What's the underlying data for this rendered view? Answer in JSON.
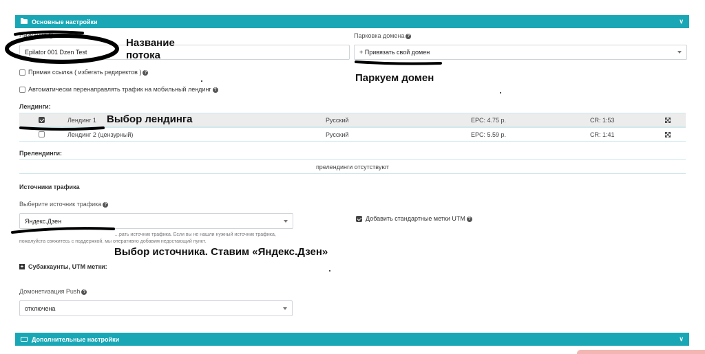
{
  "main_settings": {
    "title": "Основные настройки"
  },
  "extra_settings": {
    "title": "Дополнительные настройки"
  },
  "name_field": {
    "label": "Название",
    "value": "Epilator 001 Dzen Test"
  },
  "domain_parking": {
    "label": "Парковка домена",
    "value": "+ Привязать свой домен"
  },
  "checkboxes": {
    "direct_link": "Прямая ссылка ( избегать редиректов )",
    "mobile_redirect": "Автоматически перенаправлять трафик на мобильный лендинг"
  },
  "landings": {
    "heading": "Лендинги:",
    "rows": [
      {
        "name": "Лендинг 1",
        "lang": "Русский",
        "epc": "EPC: 4.75 р.",
        "cr": "CR: 1:53",
        "checked": true
      },
      {
        "name": "Лендинг 2 (цензурный)",
        "lang": "Русский",
        "epc": "EPC: 5.59 р.",
        "cr": "CR: 1:41",
        "checked": false
      }
    ]
  },
  "prelandings": {
    "heading": "Прелендинги:",
    "empty": "прелендинги отсутствуют"
  },
  "traffic": {
    "heading": "Источники трафика",
    "select_label": "Выберите источник трафика",
    "value": "Яндекс.Дзен",
    "hint_line1": "…рать источник трафика. Если вы не нашли нужный источник трафика,",
    "hint_line2": "пожалуйста свяжитесь с поддержкой, мы оперативно добавим недостающий пункт.",
    "utm_label": "Добавить стандартные метки UTM"
  },
  "subaccounts": {
    "label": "Субаккаунты, UTM метки:"
  },
  "push": {
    "label": "Домонетизация Push",
    "value": "отключена"
  },
  "annotations": {
    "name_flow_1": "Название",
    "name_flow_2": "потока",
    "park_domain": "Паркуем домен",
    "choose_landing": "Выбор лендинга",
    "choose_source": "Выбор источника. Ставим «Яндекс.Дзен»"
  },
  "colors": {
    "accent": "#19a7b6"
  }
}
